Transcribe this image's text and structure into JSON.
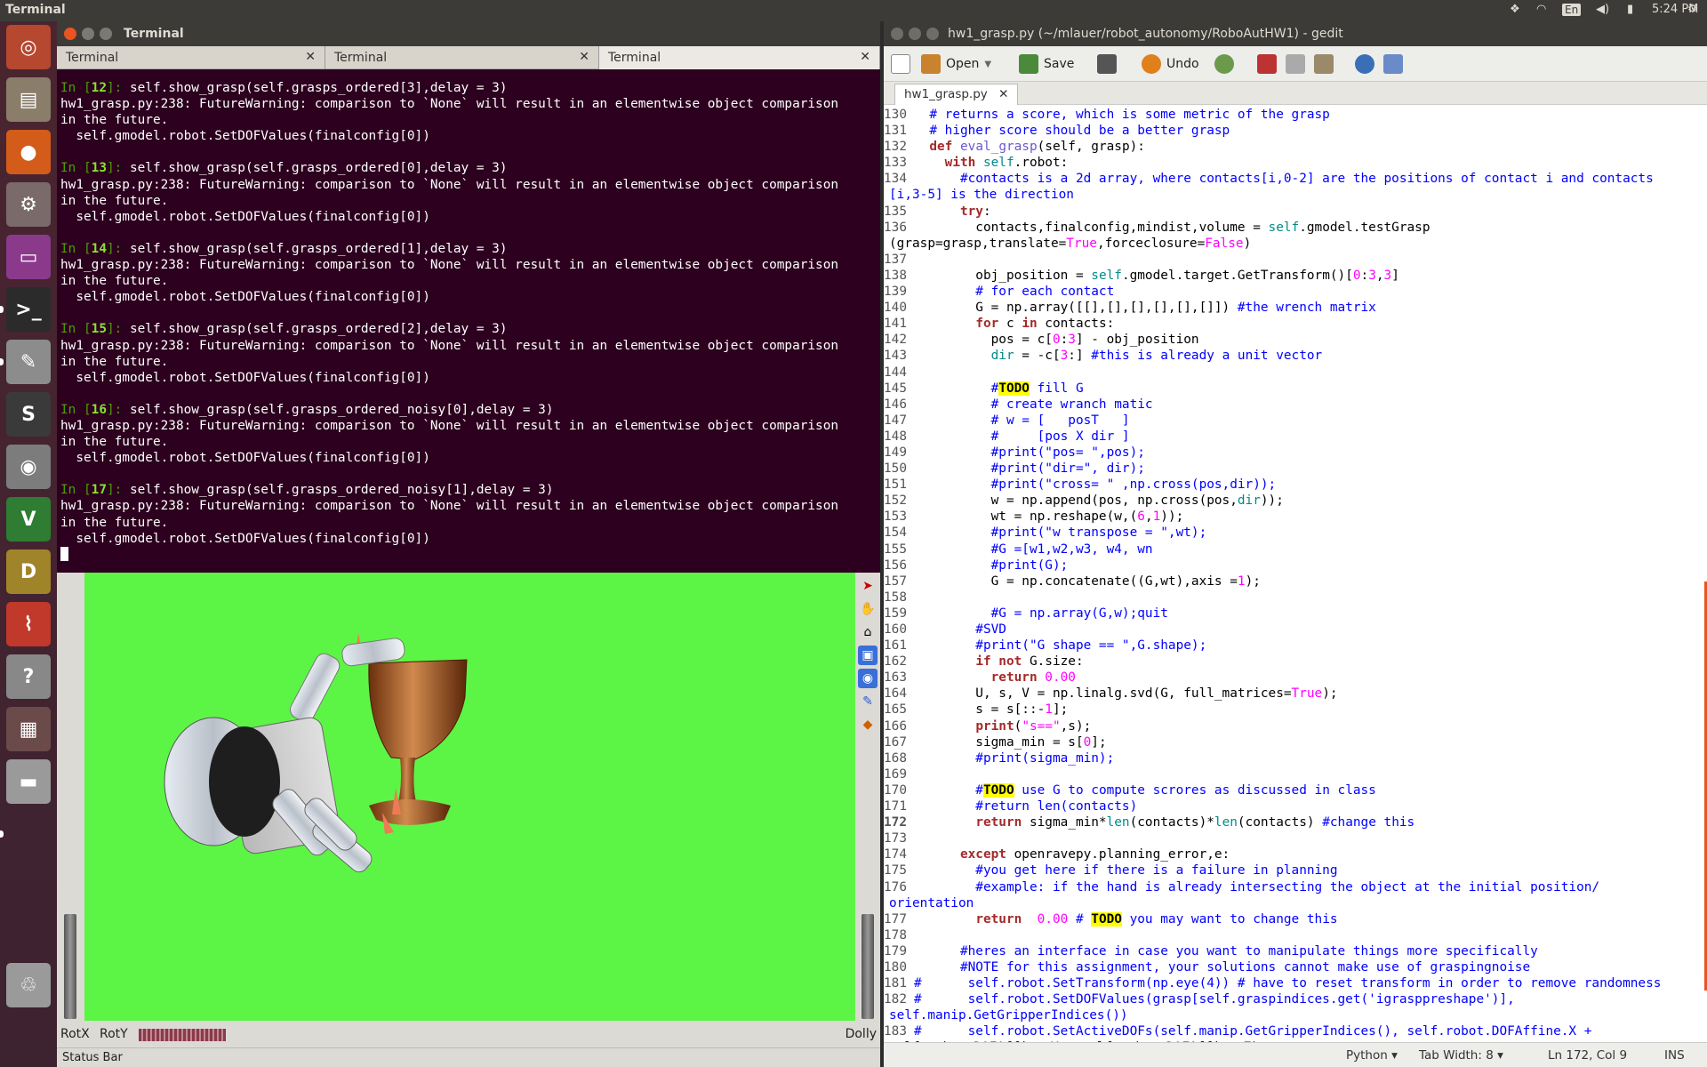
{
  "topbar": {
    "title": "Terminal",
    "lang": "En",
    "time": "5:24 PM"
  },
  "launcher": {
    "items": [
      {
        "name": "dash-icon",
        "color": "#b5482f",
        "glyph": "◎"
      },
      {
        "name": "files-icon",
        "color": "#8a7d6a",
        "glyph": "▤"
      },
      {
        "name": "firefox-icon",
        "color": "#d35c1a",
        "glyph": "●"
      },
      {
        "name": "settings-icon",
        "color": "#7a6a6a",
        "glyph": "⚙"
      },
      {
        "name": "app-window-icon",
        "color": "#8b3a8b",
        "glyph": "▭"
      },
      {
        "name": "terminal-icon",
        "color": "#2b2b2b",
        "glyph": ">_"
      },
      {
        "name": "text-editor-icon",
        "color": "#8c8c8c",
        "glyph": "✎"
      },
      {
        "name": "sublime-icon",
        "color": "#3a3a3a",
        "glyph": "S"
      },
      {
        "name": "camera-icon",
        "color": "#7c7c7c",
        "glyph": "◉"
      },
      {
        "name": "vim-icon",
        "color": "#2e7d32",
        "glyph": "V"
      },
      {
        "name": "dosbox-icon",
        "color": "#a0842a",
        "glyph": "D"
      },
      {
        "name": "pdf-reader-icon",
        "color": "#c0392b",
        "glyph": "⌇"
      },
      {
        "name": "help-icon",
        "color": "#888888",
        "glyph": "?"
      },
      {
        "name": "workspace-icon",
        "color": "#6b4a4a",
        "glyph": "▦"
      },
      {
        "name": "drive-icon",
        "color": "#9a9a9a",
        "glyph": "▬"
      },
      {
        "name": "trash-icon",
        "color": "#9a9a9a",
        "glyph": "♲"
      }
    ]
  },
  "terminal": {
    "title": "Terminal",
    "tabs": [
      "Terminal",
      "Terminal",
      "Terminal"
    ],
    "blocks": [
      {
        "prompt": "In [",
        "num": "12",
        "end": "]: ",
        "cmd": "self.show_grasp(self.grasps_ordered[3],delay = 3)"
      },
      {
        "prompt": "In [",
        "num": "13",
        "end": "]: ",
        "cmd": "self.show_grasp(self.grasps_ordered[0],delay = 3)"
      },
      {
        "prompt": "In [",
        "num": "14",
        "end": "]: ",
        "cmd": "self.show_grasp(self.grasps_ordered[1],delay = 3)"
      },
      {
        "prompt": "In [",
        "num": "15",
        "end": "]: ",
        "cmd": "self.show_grasp(self.grasps_ordered[2],delay = 3)"
      },
      {
        "prompt": "In [",
        "num": "16",
        "end": "]: ",
        "cmd": "self.show_grasp(self.grasps_ordered_noisy[0],delay = 3)"
      },
      {
        "prompt": "In [",
        "num": "17",
        "end": "]: ",
        "cmd": "self.show_grasp(self.grasps_ordered_noisy[1],delay = 3)"
      }
    ],
    "warn1": "hw1_grasp.py:238: FutureWarning: comparison to `None` will result in an elementwise object comparison",
    "warn2": "in the future.",
    "warn3": "  self.gmodel.robot.SetDOFValues(finalconfig[0])"
  },
  "viewer": {
    "rotx": "RotX",
    "roty": "RotY",
    "dolly": "Dolly",
    "status": "Status Bar"
  },
  "gedit": {
    "title": "hw1_grasp.py (~/mlauer/robot_autonomy/RoboAutHW1) - gedit",
    "open": "Open",
    "save": "Save",
    "undo": "Undo",
    "tab": "hw1_grasp.py",
    "status": {
      "lang": "Python ▾",
      "tabwidth": "Tab Width: 8 ▾",
      "pos": "Ln 172, Col 9",
      "mode": "INS"
    }
  }
}
